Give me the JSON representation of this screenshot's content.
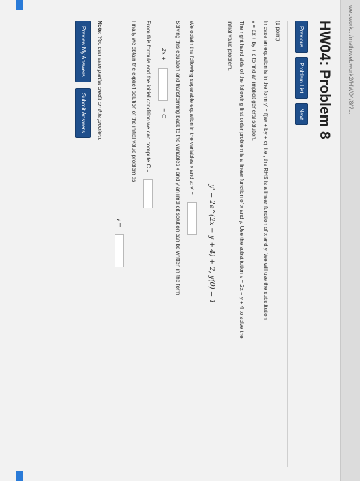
{
  "browser": {
    "url_fragment": "webwork.../math/webwork2/HW04/8/?..."
  },
  "page": {
    "title": "HW04: Problem 8",
    "nav": {
      "previous": "Previous",
      "problem_list": "Problem List",
      "next": "Next"
    }
  },
  "problem": {
    "points": "(1 point)",
    "intro_1": "In case an equation is in the form y' = f(ax + by + c), i.e., the RHS is a linear function of x and y. We will use the substitution",
    "intro_2": "v = ax + by + c to find an implicit general solution.",
    "intro_3": "The right hand side of the following first order problem is a linear function of x and y. Use the substitution v = 2x − y + 4 to solve the",
    "intro_4": "initial value problem.",
    "equation": "y' = 2e^(2x − y + 4) + 2,   y(0) = 1",
    "separable_text": "We obtain the following separable equation in the variables x and v:  v' =",
    "implicit_text": "Solving this equation and transforming back to the variables x and y an implicit solution can be written in the form",
    "implicit_lhs": "2x +",
    "implicit_rhs": "= C",
    "compute_text": "From this formula and the initial condition we can compute C =",
    "explicit_text": "Finally we obtain the explicit solution of the initial value problem as",
    "y_label": "y ="
  },
  "footer": {
    "note_bold": "Note:",
    "note_text": " You can earn partial credit on this problem.",
    "preview": "Preview My Answers",
    "submit": "Submit Answers"
  },
  "colors": {
    "button": "#1f4f8c",
    "accent": "#2a7bd8"
  }
}
